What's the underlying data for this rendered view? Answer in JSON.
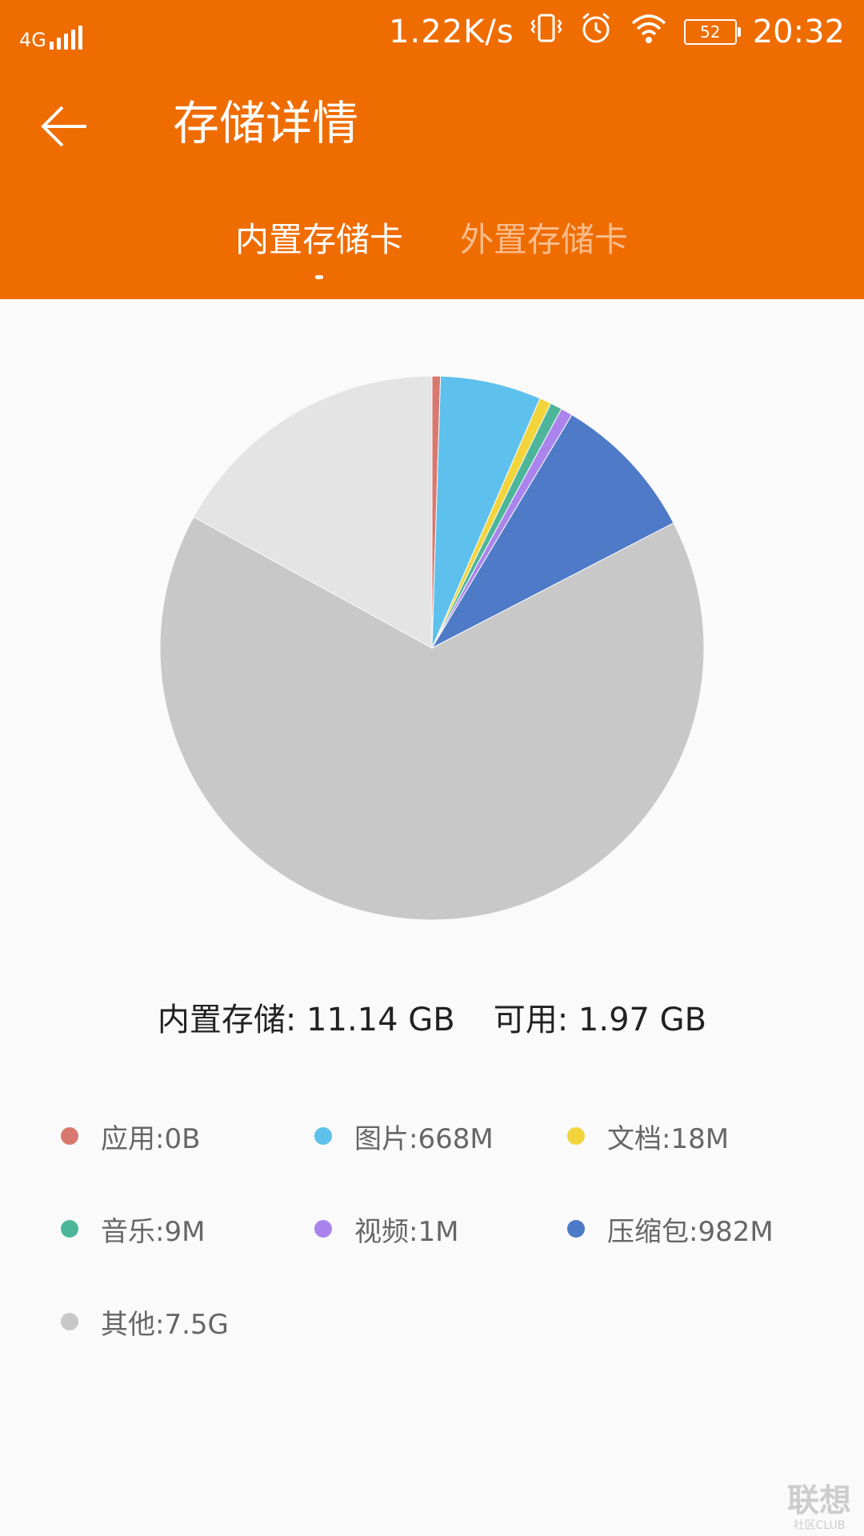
{
  "status_bar": {
    "network_type": "4G",
    "speed": "1.22K/s",
    "battery": "52",
    "time": "20:32"
  },
  "header": {
    "title": "存储详情",
    "tabs": [
      {
        "label": "内置存储卡"
      },
      {
        "label": "外置存储卡"
      }
    ],
    "colors": {
      "background": "#ef6c00"
    }
  },
  "summary": {
    "internal": "内置存储: 11.14 GB",
    "available": "可用: 1.97 GB"
  },
  "legend": [
    {
      "label": "应用:0B",
      "color": "#d9786e"
    },
    {
      "label": "图片:668M",
      "color": "#5ec0ec"
    },
    {
      "label": "文档:18M",
      "color": "#f2d43d"
    },
    {
      "label": "音乐:9M",
      "color": "#4db69a"
    },
    {
      "label": "视频:1M",
      "color": "#aa84ec"
    },
    {
      "label": "压缩包:982M",
      "color": "#4e7ac7"
    },
    {
      "label": "其他:7.5G",
      "color": "#c8c8c8"
    }
  ],
  "watermark": {
    "main": "联想",
    "sub": "社区CLUB"
  },
  "chart_data": {
    "type": "pie",
    "categories": [
      "应用",
      "图片",
      "文档",
      "音乐",
      "视频",
      "压缩包",
      "其他",
      "可用"
    ],
    "values": [
      0.5,
      6.0,
      0.7,
      0.7,
      0.7,
      8.8,
      65.6,
      17.0
    ],
    "colors": [
      "#d9786e",
      "#5ec0ec",
      "#f2d43d",
      "#4db69a",
      "#aa84ec",
      "#4e7ac7",
      "#c8c8c8",
      "#e4e4e4"
    ],
    "unit": "percent",
    "start_angle": "top",
    "direction": "clockwise"
  }
}
